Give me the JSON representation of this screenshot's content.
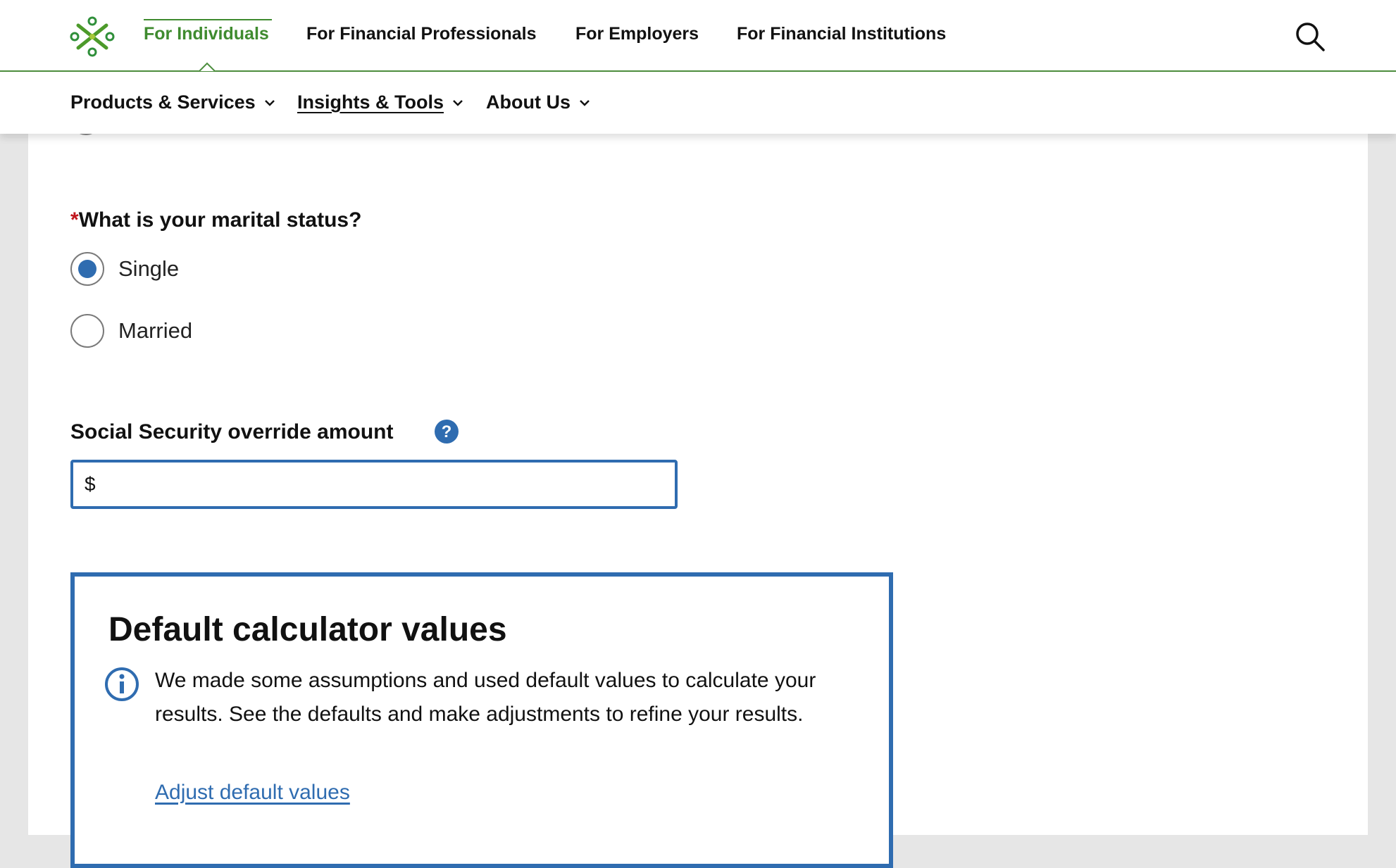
{
  "header": {
    "tabs": [
      {
        "label": "For Individuals",
        "active": true
      },
      {
        "label": "For Financial Professionals"
      },
      {
        "label": "For Employers"
      },
      {
        "label": "For Financial Institutions"
      }
    ],
    "search_icon": "search-icon",
    "logo_icon": "flower-logo-icon"
  },
  "subnav": {
    "items": [
      {
        "label": "Products & Services",
        "icon": "chevron-down-icon"
      },
      {
        "label": "Insights & Tools",
        "icon": "chevron-down-icon",
        "current": true
      },
      {
        "label": "About Us",
        "icon": "chevron-down-icon"
      }
    ]
  },
  "form": {
    "marital": {
      "required_marker": "*",
      "question": "What is your marital status?",
      "options": [
        {
          "label": "Single",
          "checked": true
        },
        {
          "label": "Married",
          "checked": false
        }
      ]
    },
    "social_security": {
      "label": "Social Security override amount",
      "help_icon": "question-circle-icon",
      "placeholder": "$"
    }
  },
  "defaults": {
    "title": "Default calculator values",
    "info_icon": "info-circle-icon",
    "text": "We made some assumptions and used default values to calculate your results. See the defaults and make adjustments to refine your results.",
    "link": "Adjust default values"
  },
  "colors": {
    "brand_green": "#3f8b2f",
    "accent_blue": "#2f6cb0",
    "required_red": "#c0161d"
  }
}
